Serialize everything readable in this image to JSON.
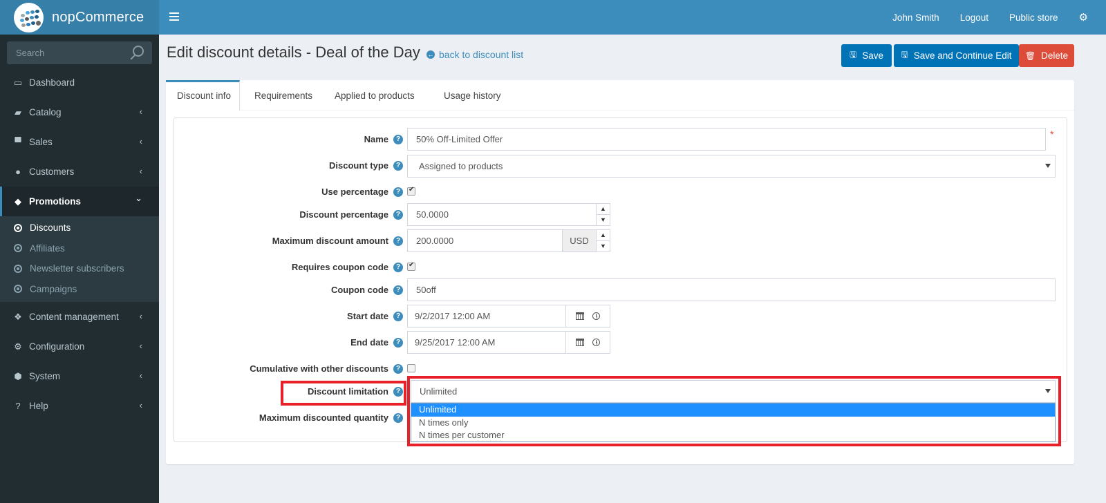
{
  "header": {
    "brand": "nopCommerce",
    "user_name": "John Smith",
    "logout": "Logout",
    "public_store": "Public store",
    "settings_icon": "gears-icon",
    "menu_toggle_icon": "hamburger-icon"
  },
  "sidebar": {
    "search_placeholder": "Search",
    "items": [
      {
        "label": "Dashboard",
        "icon": "desktop-icon",
        "chevron": ""
      },
      {
        "label": "Catalog",
        "icon": "book-icon",
        "chevron": "‹"
      },
      {
        "label": "Sales",
        "icon": "cart-icon",
        "chevron": "‹"
      },
      {
        "label": "Customers",
        "icon": "user-icon",
        "chevron": "‹"
      },
      {
        "label": "Promotions",
        "icon": "tags-icon",
        "chevron": "⌄",
        "active": true
      },
      {
        "label": "Content management",
        "icon": "cubes-icon",
        "chevron": "‹"
      },
      {
        "label": "Configuration",
        "icon": "gears-icon",
        "chevron": "‹"
      },
      {
        "label": "System",
        "icon": "cube-icon",
        "chevron": "‹"
      },
      {
        "label": "Help",
        "icon": "question-circle-icon",
        "chevron": "‹"
      }
    ],
    "promotions_submenu": [
      {
        "label": "Discounts",
        "active": true
      },
      {
        "label": "Affiliates"
      },
      {
        "label": "Newsletter subscribers"
      },
      {
        "label": "Campaigns"
      }
    ]
  },
  "page": {
    "title": "Edit discount details - Deal of the Day",
    "back_link": "back to discount list",
    "buttons": {
      "save": "Save",
      "save_continue": "Save and Continue Edit",
      "delete": "Delete"
    },
    "tabs": [
      "Discount info",
      "Requirements",
      "Applied to products",
      "Usage history"
    ],
    "active_tab": "Discount info"
  },
  "form": {
    "name": {
      "label": "Name",
      "value": "50% Off-Limited Offer",
      "required": "*"
    },
    "discount_type": {
      "label": "Discount type",
      "value": "Assigned to products"
    },
    "use_percentage": {
      "label": "Use percentage",
      "checked": true
    },
    "discount_percentage": {
      "label": "Discount percentage",
      "value": "50.0000"
    },
    "max_discount_amount": {
      "label": "Maximum discount amount",
      "value": "200.0000",
      "currency": "USD"
    },
    "requires_coupon": {
      "label": "Requires coupon code",
      "checked": true
    },
    "coupon_code": {
      "label": "Coupon code",
      "value": "50off"
    },
    "start_date": {
      "label": "Start date",
      "value": "9/2/2017 12:00 AM"
    },
    "end_date": {
      "label": "End date",
      "value": "9/25/2017 12:00 AM"
    },
    "cumulative": {
      "label": "Cumulative with other discounts",
      "checked": false
    },
    "discount_limitation": {
      "label": "Discount limitation",
      "value": "Unlimited",
      "options": [
        "Unlimited",
        "N times only",
        "N times per customer"
      ],
      "selected_index": 0
    },
    "max_discounted_quantity": {
      "label": "Maximum discounted quantity"
    }
  },
  "colors": {
    "header": "#3c8dbc",
    "sidebar": "#222d32",
    "primary_button": "#0073b7",
    "delete_button": "#dd4b39",
    "highlight_box": "#e8202a",
    "selected_option": "#1e90ff"
  }
}
